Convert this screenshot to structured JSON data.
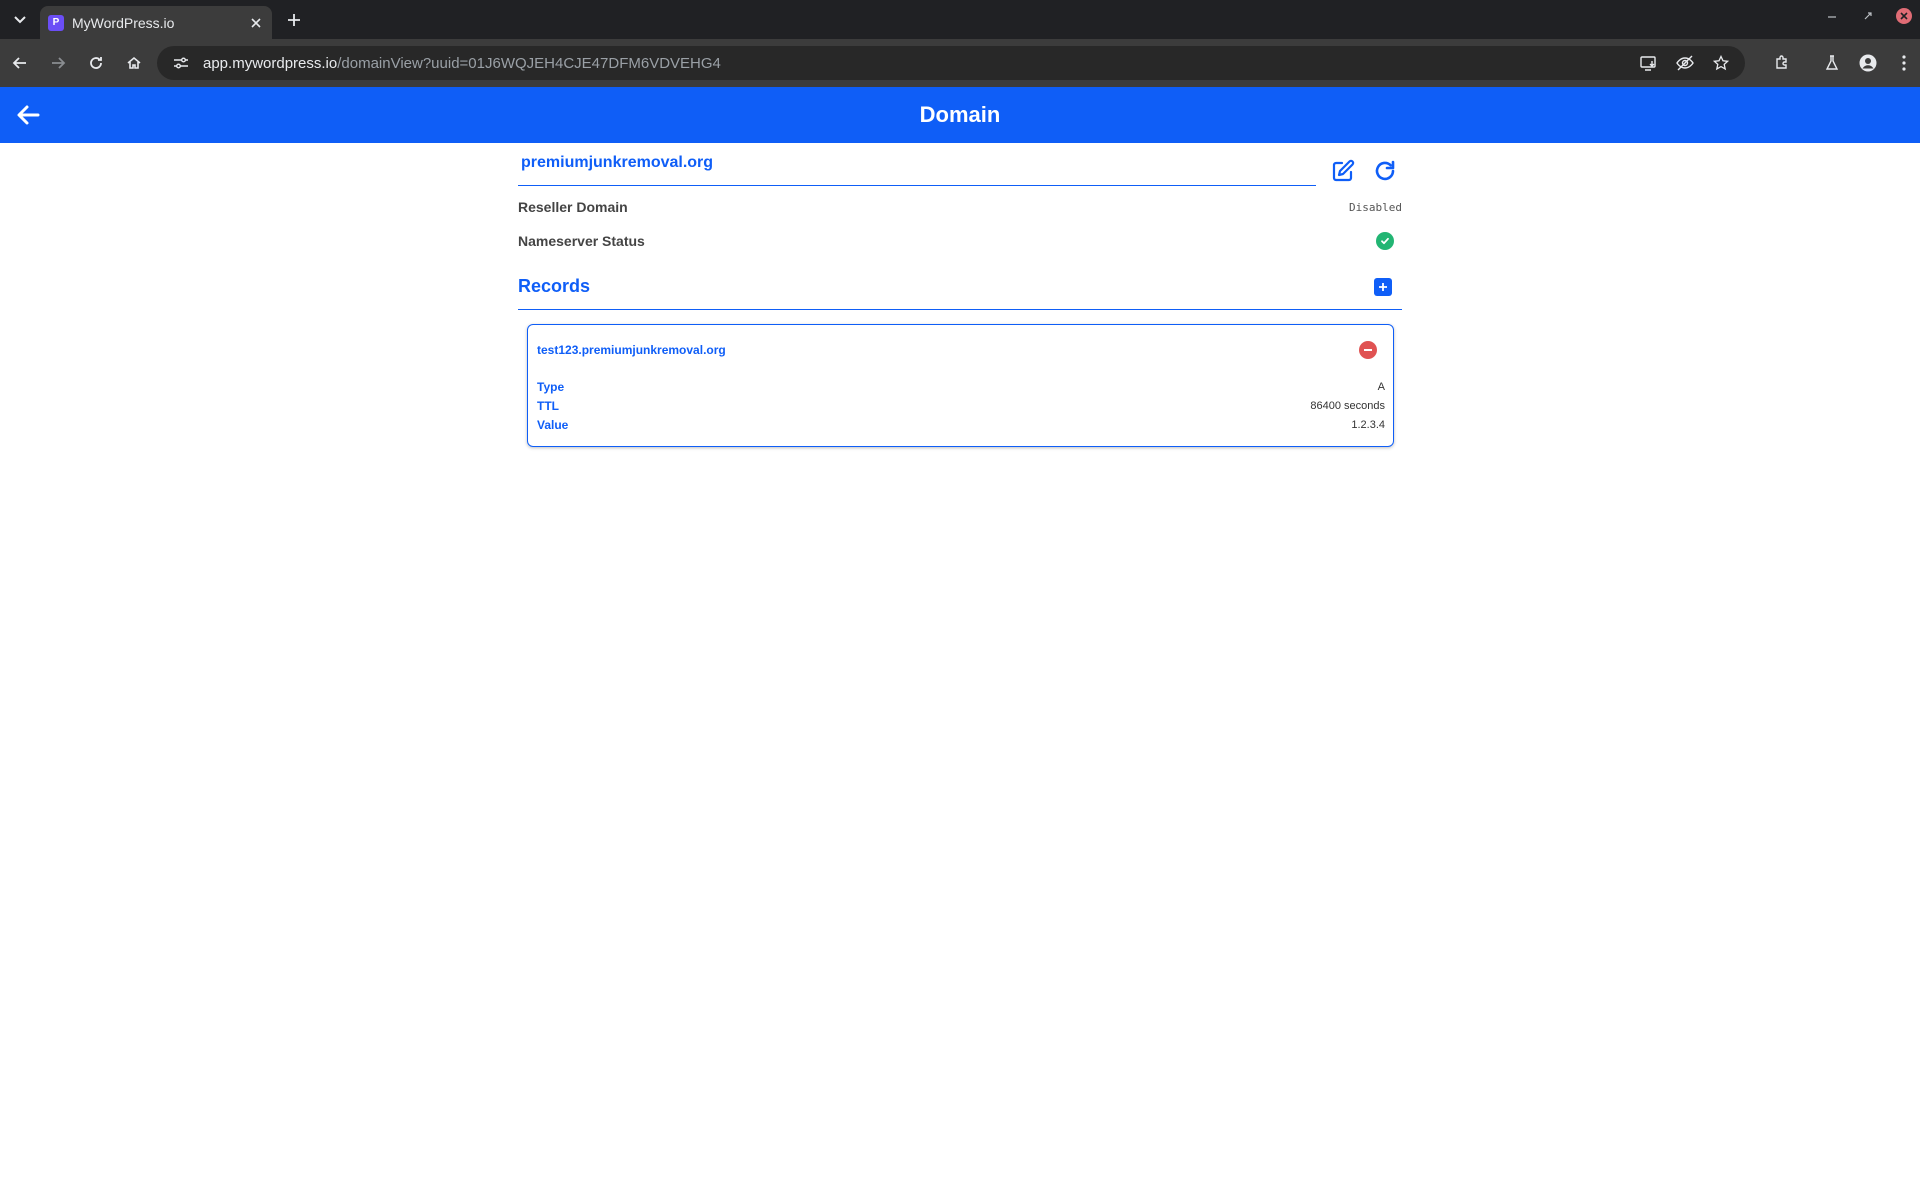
{
  "browser": {
    "tab_title": "MyWordPress.io",
    "favicon_letter": "P",
    "url_host": "app.mywordpress.io",
    "url_path": "/domainView?uuid=01J6WQJEH4CJE47DFM6VDVEHG4"
  },
  "app": {
    "title": "Domain"
  },
  "domain": {
    "name": "premiumjunkremoval.org",
    "reseller_label": "Reseller Domain",
    "reseller_value": "Disabled",
    "nameserver_label": "Nameserver Status",
    "nameserver_status": "ok"
  },
  "records": {
    "title": "Records",
    "items": [
      {
        "name": "test123.premiumjunkremoval.org",
        "type_label": "Type",
        "type_value": "A",
        "ttl_label": "TTL",
        "ttl_value": "86400 seconds",
        "value_label": "Value",
        "value_value": "1.2.3.4"
      }
    ]
  },
  "colors": {
    "accent": "#0f5ef7",
    "success": "#22b573",
    "danger": "#e05252"
  }
}
